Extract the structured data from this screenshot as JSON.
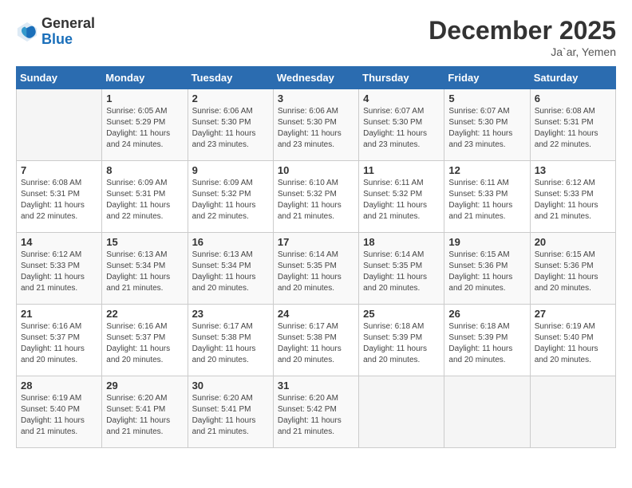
{
  "logo": {
    "general": "General",
    "blue": "Blue"
  },
  "header": {
    "month_year": "December 2025",
    "location": "Ja`ar, Yemen"
  },
  "weekdays": [
    "Sunday",
    "Monday",
    "Tuesday",
    "Wednesday",
    "Thursday",
    "Friday",
    "Saturday"
  ],
  "weeks": [
    [
      {
        "day": "",
        "sunrise": "",
        "sunset": "",
        "daylight": ""
      },
      {
        "day": "1",
        "sunrise": "Sunrise: 6:05 AM",
        "sunset": "Sunset: 5:29 PM",
        "daylight": "Daylight: 11 hours and 24 minutes."
      },
      {
        "day": "2",
        "sunrise": "Sunrise: 6:06 AM",
        "sunset": "Sunset: 5:30 PM",
        "daylight": "Daylight: 11 hours and 23 minutes."
      },
      {
        "day": "3",
        "sunrise": "Sunrise: 6:06 AM",
        "sunset": "Sunset: 5:30 PM",
        "daylight": "Daylight: 11 hours and 23 minutes."
      },
      {
        "day": "4",
        "sunrise": "Sunrise: 6:07 AM",
        "sunset": "Sunset: 5:30 PM",
        "daylight": "Daylight: 11 hours and 23 minutes."
      },
      {
        "day": "5",
        "sunrise": "Sunrise: 6:07 AM",
        "sunset": "Sunset: 5:30 PM",
        "daylight": "Daylight: 11 hours and 23 minutes."
      },
      {
        "day": "6",
        "sunrise": "Sunrise: 6:08 AM",
        "sunset": "Sunset: 5:31 PM",
        "daylight": "Daylight: 11 hours and 22 minutes."
      }
    ],
    [
      {
        "day": "7",
        "sunrise": "Sunrise: 6:08 AM",
        "sunset": "Sunset: 5:31 PM",
        "daylight": "Daylight: 11 hours and 22 minutes."
      },
      {
        "day": "8",
        "sunrise": "Sunrise: 6:09 AM",
        "sunset": "Sunset: 5:31 PM",
        "daylight": "Daylight: 11 hours and 22 minutes."
      },
      {
        "day": "9",
        "sunrise": "Sunrise: 6:09 AM",
        "sunset": "Sunset: 5:32 PM",
        "daylight": "Daylight: 11 hours and 22 minutes."
      },
      {
        "day": "10",
        "sunrise": "Sunrise: 6:10 AM",
        "sunset": "Sunset: 5:32 PM",
        "daylight": "Daylight: 11 hours and 21 minutes."
      },
      {
        "day": "11",
        "sunrise": "Sunrise: 6:11 AM",
        "sunset": "Sunset: 5:32 PM",
        "daylight": "Daylight: 11 hours and 21 minutes."
      },
      {
        "day": "12",
        "sunrise": "Sunrise: 6:11 AM",
        "sunset": "Sunset: 5:33 PM",
        "daylight": "Daylight: 11 hours and 21 minutes."
      },
      {
        "day": "13",
        "sunrise": "Sunrise: 6:12 AM",
        "sunset": "Sunset: 5:33 PM",
        "daylight": "Daylight: 11 hours and 21 minutes."
      }
    ],
    [
      {
        "day": "14",
        "sunrise": "Sunrise: 6:12 AM",
        "sunset": "Sunset: 5:33 PM",
        "daylight": "Daylight: 11 hours and 21 minutes."
      },
      {
        "day": "15",
        "sunrise": "Sunrise: 6:13 AM",
        "sunset": "Sunset: 5:34 PM",
        "daylight": "Daylight: 11 hours and 21 minutes."
      },
      {
        "day": "16",
        "sunrise": "Sunrise: 6:13 AM",
        "sunset": "Sunset: 5:34 PM",
        "daylight": "Daylight: 11 hours and 20 minutes."
      },
      {
        "day": "17",
        "sunrise": "Sunrise: 6:14 AM",
        "sunset": "Sunset: 5:35 PM",
        "daylight": "Daylight: 11 hours and 20 minutes."
      },
      {
        "day": "18",
        "sunrise": "Sunrise: 6:14 AM",
        "sunset": "Sunset: 5:35 PM",
        "daylight": "Daylight: 11 hours and 20 minutes."
      },
      {
        "day": "19",
        "sunrise": "Sunrise: 6:15 AM",
        "sunset": "Sunset: 5:36 PM",
        "daylight": "Daylight: 11 hours and 20 minutes."
      },
      {
        "day": "20",
        "sunrise": "Sunrise: 6:15 AM",
        "sunset": "Sunset: 5:36 PM",
        "daylight": "Daylight: 11 hours and 20 minutes."
      }
    ],
    [
      {
        "day": "21",
        "sunrise": "Sunrise: 6:16 AM",
        "sunset": "Sunset: 5:37 PM",
        "daylight": "Daylight: 11 hours and 20 minutes."
      },
      {
        "day": "22",
        "sunrise": "Sunrise: 6:16 AM",
        "sunset": "Sunset: 5:37 PM",
        "daylight": "Daylight: 11 hours and 20 minutes."
      },
      {
        "day": "23",
        "sunrise": "Sunrise: 6:17 AM",
        "sunset": "Sunset: 5:38 PM",
        "daylight": "Daylight: 11 hours and 20 minutes."
      },
      {
        "day": "24",
        "sunrise": "Sunrise: 6:17 AM",
        "sunset": "Sunset: 5:38 PM",
        "daylight": "Daylight: 11 hours and 20 minutes."
      },
      {
        "day": "25",
        "sunrise": "Sunrise: 6:18 AM",
        "sunset": "Sunset: 5:39 PM",
        "daylight": "Daylight: 11 hours and 20 minutes."
      },
      {
        "day": "26",
        "sunrise": "Sunrise: 6:18 AM",
        "sunset": "Sunset: 5:39 PM",
        "daylight": "Daylight: 11 hours and 20 minutes."
      },
      {
        "day": "27",
        "sunrise": "Sunrise: 6:19 AM",
        "sunset": "Sunset: 5:40 PM",
        "daylight": "Daylight: 11 hours and 20 minutes."
      }
    ],
    [
      {
        "day": "28",
        "sunrise": "Sunrise: 6:19 AM",
        "sunset": "Sunset: 5:40 PM",
        "daylight": "Daylight: 11 hours and 21 minutes."
      },
      {
        "day": "29",
        "sunrise": "Sunrise: 6:20 AM",
        "sunset": "Sunset: 5:41 PM",
        "daylight": "Daylight: 11 hours and 21 minutes."
      },
      {
        "day": "30",
        "sunrise": "Sunrise: 6:20 AM",
        "sunset": "Sunset: 5:41 PM",
        "daylight": "Daylight: 11 hours and 21 minutes."
      },
      {
        "day": "31",
        "sunrise": "Sunrise: 6:20 AM",
        "sunset": "Sunset: 5:42 PM",
        "daylight": "Daylight: 11 hours and 21 minutes."
      },
      {
        "day": "",
        "sunrise": "",
        "sunset": "",
        "daylight": ""
      },
      {
        "day": "",
        "sunrise": "",
        "sunset": "",
        "daylight": ""
      },
      {
        "day": "",
        "sunrise": "",
        "sunset": "",
        "daylight": ""
      }
    ]
  ]
}
